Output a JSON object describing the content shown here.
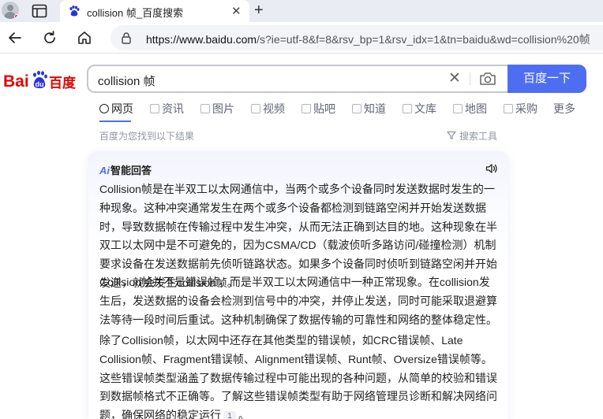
{
  "browser": {
    "tab_title": "collision 帧_百度搜索",
    "tab_close": "✕",
    "new_tab": "+",
    "url_host": "https://www.baidu.com",
    "url_path": "/s?ie=utf-8&f=8&rsv_bp=1&rsv_idx=1&tn=baidu&wd=collision%20帧"
  },
  "search": {
    "query": "collision 帧",
    "button": "百度一下",
    "clear": "✕"
  },
  "nav": {
    "tabs": [
      "网页",
      "资讯",
      "图片",
      "视频",
      "贴吧",
      "知道",
      "文库",
      "地图",
      "采购",
      "更多"
    ],
    "active": "网页"
  },
  "results": {
    "note": "百度为您找到以下结果",
    "tools": "搜索工具"
  },
  "ai_answer": {
    "badge": "Ai",
    "title": "智能回答",
    "paragraphs": [
      "Collision帧是在半双工以太网通信中，当两个或多个设备同时发送数据时发生的一种现象。这种冲突通常发生在两个或多个设备都检测到链路空闲并开始发送数据时，导致数据帧在传输过程中发生冲突，从而无法正确到达目的地。这种现象在半双工以太网中是不可避免的，因为CSMA/CD（载波侦听多路访问/碰撞检测）机制要求设备在发送数据前先侦听链路状态。如果多个设备同时侦听到链路空闲并开始发送，就会发生collision帧。",
      "Collision帧并不是错误帧，而是半双工以太网通信中一种正常现象。在collision发生后，发送数据的设备会检测到信号中的冲突，并停止发送，同时可能采取退避算法等待一段时间后重试。这种机制确保了数据传输的可靠性和网络的整体稳定性。",
      "除了Collision帧，以太网中还存在其他类型的错误帧，如CRC错误帧、Late Collision帧、Fragment错误帧、Alignment错误帧、Runt帧、Oversize错误帧等。这些错误帧类型涵盖了数据传输过程中可能出现的各种问题，从简单的校验和错误到数据帧格式不正确等。了解这些错误帧类型有助于网络管理员诊断和解决网络问题，确保网络的稳定运行"
    ],
    "citation": "1",
    "end_punct": "。"
  },
  "colors": {
    "accent": "#4e6ef2",
    "tab_bar": "#e9edf3",
    "muted": "#9195a3"
  },
  "icons": [
    "profile-avatar",
    "workspaces-icon",
    "baidu-paw-icon",
    "back-arrow-icon",
    "refresh-icon",
    "home-icon",
    "lock-icon",
    "camera-icon",
    "filter-icon",
    "speaker-icon"
  ]
}
